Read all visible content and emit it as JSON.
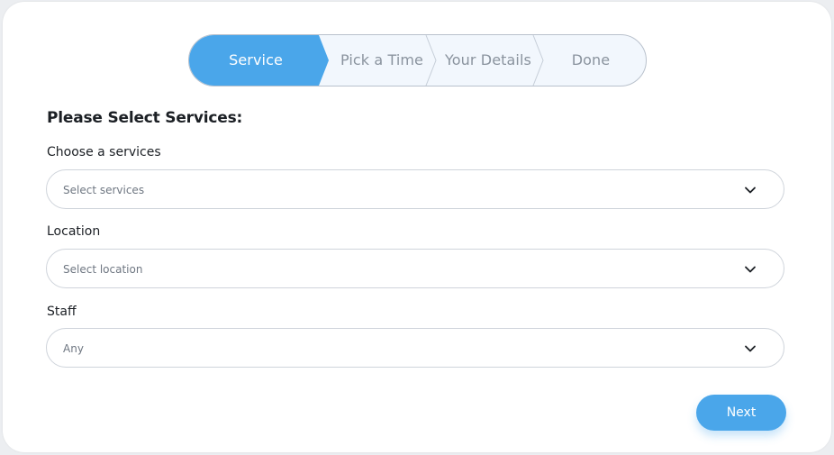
{
  "stepper": {
    "steps": [
      {
        "label": "Service",
        "active": true
      },
      {
        "label": "Pick a Time",
        "active": false
      },
      {
        "label": "Your Details",
        "active": false
      },
      {
        "label": "Done",
        "active": false
      }
    ],
    "active_color": "#4aa6ea",
    "inactive_color": "#f2f7fd"
  },
  "form": {
    "heading": "Please Select Services:",
    "fields": [
      {
        "label": "Choose a services",
        "placeholder": "Select services"
      },
      {
        "label": "Location",
        "placeholder": "Select location"
      },
      {
        "label": "Staff",
        "value": "Any"
      }
    ]
  },
  "actions": {
    "next_label": "Next"
  }
}
